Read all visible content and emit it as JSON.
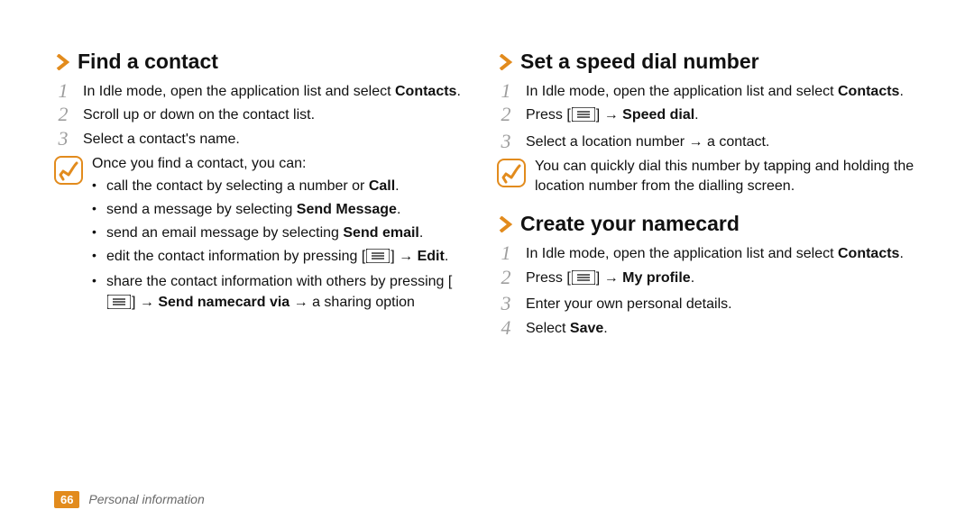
{
  "leftColumn": {
    "section1": {
      "title": "Find a contact",
      "steps": {
        "s1": {
          "num": "1",
          "pre": "In Idle mode, open the application list and select ",
          "bold": "Contacts",
          "post": "."
        },
        "s2": {
          "num": "2",
          "text": "Scroll up or down on the contact list."
        },
        "s3": {
          "num": "3",
          "text": "Select a contact's name."
        }
      },
      "note": {
        "intro": "Once you find a contact, you can:",
        "b1": {
          "pre": "call the contact by selecting a number or ",
          "bold": "Call",
          "post": "."
        },
        "b2": {
          "pre": "send a message by selecting ",
          "bold": "Send Message",
          "post": "."
        },
        "b3": {
          "pre": "send an email message by selecting ",
          "bold": "Send email",
          "post": "."
        },
        "b4": {
          "pre": "edit the contact information by pressing [",
          "post": "] → ",
          "bold": "Edit",
          "tail": "."
        },
        "b5": {
          "pre": "share the contact information with others by pressing [",
          "post": "] → ",
          "bold": "Send namecard via",
          "tail": " → a sharing option"
        }
      }
    }
  },
  "rightColumn": {
    "section1": {
      "title": "Set a speed dial number",
      "steps": {
        "s1": {
          "num": "1",
          "pre": "In Idle mode, open the application list and select ",
          "bold": "Contacts",
          "post": "."
        },
        "s2": {
          "num": "2",
          "pre": "Press [",
          "post": "] → ",
          "bold": "Speed dial",
          "tail": "."
        },
        "s3": {
          "num": "3",
          "text": "Select a location number → a contact."
        }
      },
      "note": "You can quickly dial this number by tapping and holding the location number from the dialling screen."
    },
    "section2": {
      "title": "Create your namecard",
      "steps": {
        "s1": {
          "num": "1",
          "pre": "In Idle mode, open the application list and select ",
          "bold": "Contacts",
          "post": "."
        },
        "s2": {
          "num": "2",
          "pre": "Press [",
          "post": "] → ",
          "bold": "My profile",
          "tail": "."
        },
        "s3": {
          "num": "3",
          "text": "Enter your own personal details."
        },
        "s4": {
          "num": "4",
          "pre": "Select ",
          "bold": "Save",
          "post": "."
        }
      }
    }
  },
  "footer": {
    "page": "66",
    "chapter": "Personal information"
  }
}
